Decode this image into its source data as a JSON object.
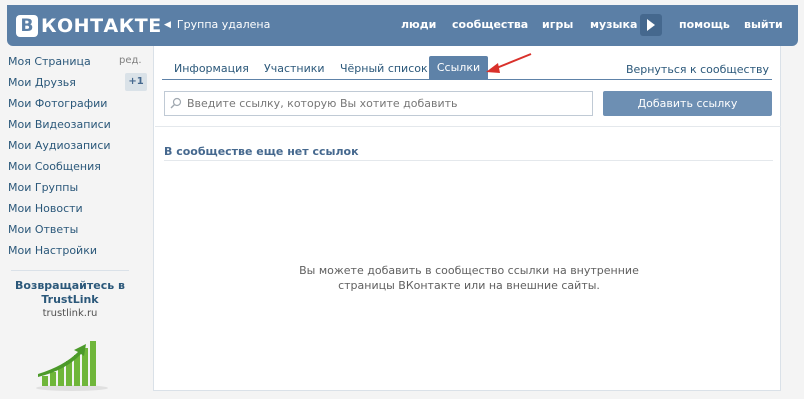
{
  "header": {
    "logo_letter": "В",
    "logo_text": "КОНТАКТЕ",
    "back_label": "Группа удалена",
    "nav": [
      "люди",
      "сообщества",
      "игры",
      "музыка",
      "помощь",
      "выйти"
    ]
  },
  "left_menu": {
    "edit_label": "ред.",
    "friends_badge": "+1",
    "items": [
      "Моя Страница",
      "Мои Друзья",
      "Мои Фотографии",
      "Мои Видеозаписи",
      "Мои Аудиозаписи",
      "Мои Сообщения",
      "Мои Группы",
      "Мои Новости",
      "Мои Ответы",
      "Мои Настройки"
    ],
    "promo": {
      "title_line1": "Возвращайтесь в",
      "title_line2": "TrustLink",
      "url": "trustlink.ru"
    }
  },
  "tabs": {
    "items": [
      "Информация",
      "Участники",
      "Чёрный список"
    ],
    "active": "Ссылки",
    "back_link": "Вернуться к сообществу"
  },
  "form": {
    "input_placeholder": "Введите ссылку, которую Вы хотите добавить",
    "add_button": "Добавить ссылку"
  },
  "section": {
    "title": "В сообществе еще нет ссылок",
    "empty_line1": "Вы можете добавить в сообщество ссылки на внутренние",
    "empty_line2": "страницы ВКонтакте или на внешние сайты."
  },
  "colors": {
    "header_bg": "#5b7fa6",
    "link": "#2b587a",
    "button": "#6d8fb3",
    "annotation_arrow": "#d9312b"
  },
  "icons": {
    "search": "magnifier",
    "play": "triangle-right",
    "back": "chevron-left"
  }
}
